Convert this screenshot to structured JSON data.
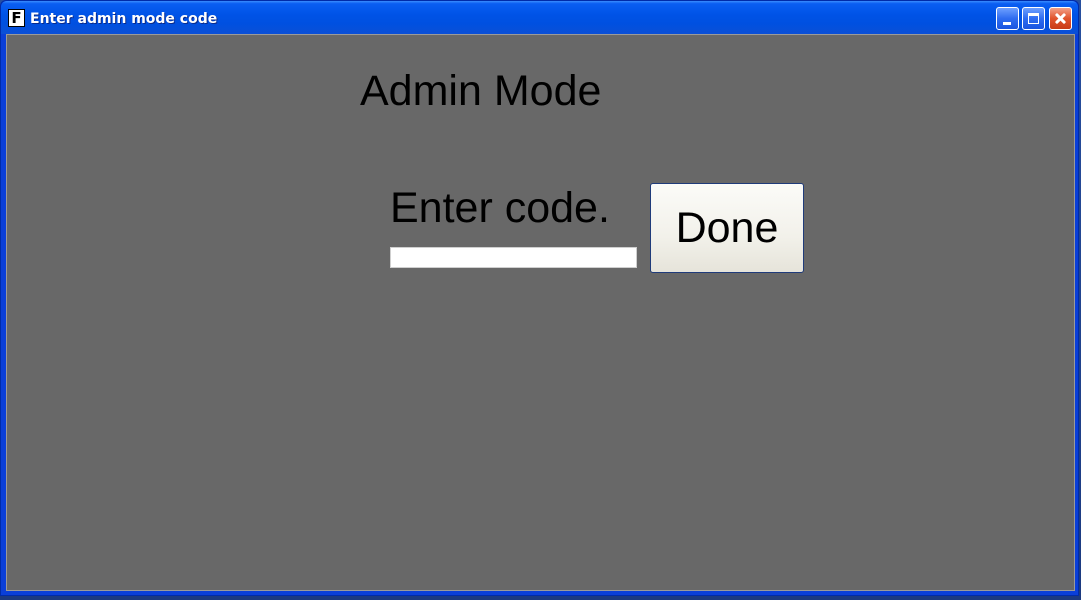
{
  "window": {
    "title": "Enter admin mode code",
    "app_icon_glyph": "F",
    "controls": {
      "minimize": "minimize-icon",
      "maximize": "maximize-icon",
      "close": "close-icon"
    }
  },
  "form": {
    "heading": "Admin Mode",
    "prompt": "Enter code.",
    "code_value": "",
    "done_label": "Done"
  },
  "colors": {
    "titlebar": "#0053e7",
    "client_background": "#686868",
    "input_background": "#ffffff",
    "button_background": "#f2f1ea",
    "close_button": "#e0532c"
  }
}
